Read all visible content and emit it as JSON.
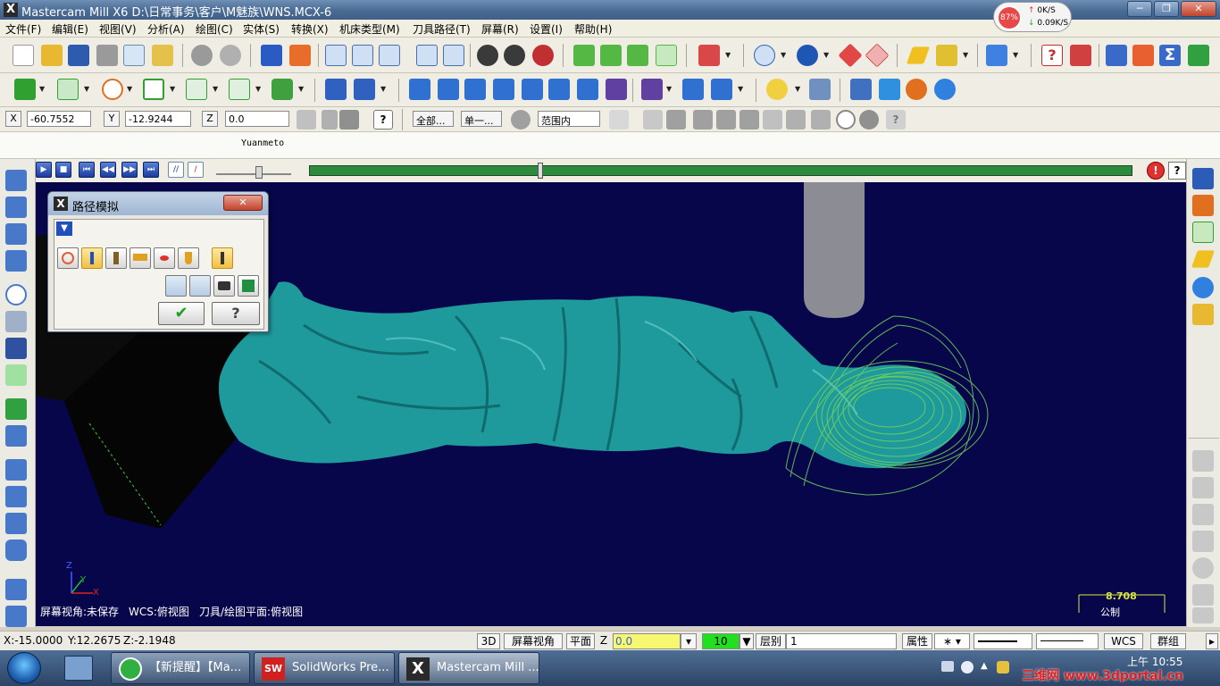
{
  "window": {
    "title": "Mastercam Mill X6  D:\\日常事务\\客户\\M魅族\\WNS.MCX-6",
    "minimize": "─",
    "maximize": "❐",
    "close": "✕"
  },
  "network_widget": {
    "cpu": "87%",
    "up": "0K/S",
    "down": "0.09K/S"
  },
  "menu": [
    "文件(F)",
    "编辑(E)",
    "视图(V)",
    "分析(A)",
    "绘图(C)",
    "实体(S)",
    "转换(X)",
    "机床类型(M)",
    "刀具路径(T)",
    "屏幕(R)",
    "设置(I)",
    "帮助(H)"
  ],
  "coords": {
    "x_label": "X",
    "x_value": "-60.7552",
    "y_label": "Y",
    "y_value": "-12.9244",
    "z_label": "Z",
    "z_value": "0.0",
    "select_all": "全部...",
    "select_single": "单一...",
    "range": "范围内"
  },
  "toolbar_caption": "Yuanmeto",
  "dialog": {
    "title": "路径模拟",
    "close": "✕",
    "ok": "✔",
    "help": "?"
  },
  "viewport": {
    "status_view": "屏幕视角:未保存",
    "status_wcs": "WCS:俯视图",
    "status_plane": "刀具/绘图平面:俯视图",
    "scale_value": "8.708",
    "scale_unit": "公制",
    "axis_z": "Z",
    "axis_y": "Y",
    "axis_x": "X"
  },
  "statusbar": {
    "x": "X:-15.0000",
    "y": "Y:12.2675",
    "z": "Z:-2.1948",
    "btn_3d": "3D",
    "btn_screen_view": "屏幕视角",
    "btn_plane": "平面",
    "z_label": "Z",
    "z_value": "0.0",
    "color_value": "10",
    "level_label": "层别",
    "level_value": "1",
    "attr": "属性",
    "wcs": "WCS",
    "group": "群组"
  },
  "taskbar": {
    "tasks": [
      "【新提醒】【Ma...",
      "SolidWorks Pre...",
      "Mastercam Mill ..."
    ],
    "clock_label": "上午 10:55",
    "watermark": "三维网 www.3dportal.cn"
  },
  "colors": {
    "viewport_bg": "#08064a",
    "model": "#1f9a9c",
    "toolpath": "#74d35a",
    "progress": "#2e8b3e"
  }
}
